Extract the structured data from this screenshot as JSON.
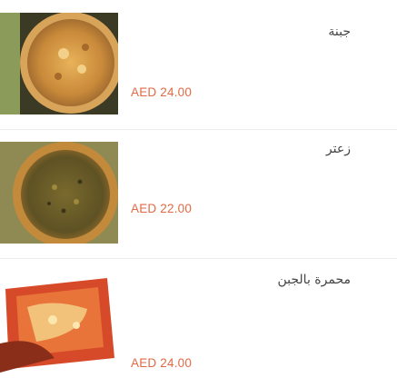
{
  "menu": {
    "items": [
      {
        "name": "جبنة",
        "price": "AED 24.00"
      },
      {
        "name": "زعتر",
        "price": "AED 22.00"
      },
      {
        "name": "محمرة بالجبن",
        "price": "AED 24.00"
      }
    ]
  },
  "colors": {
    "price": "#e16a45",
    "divider": "#ececec",
    "background": "#ffffff"
  }
}
